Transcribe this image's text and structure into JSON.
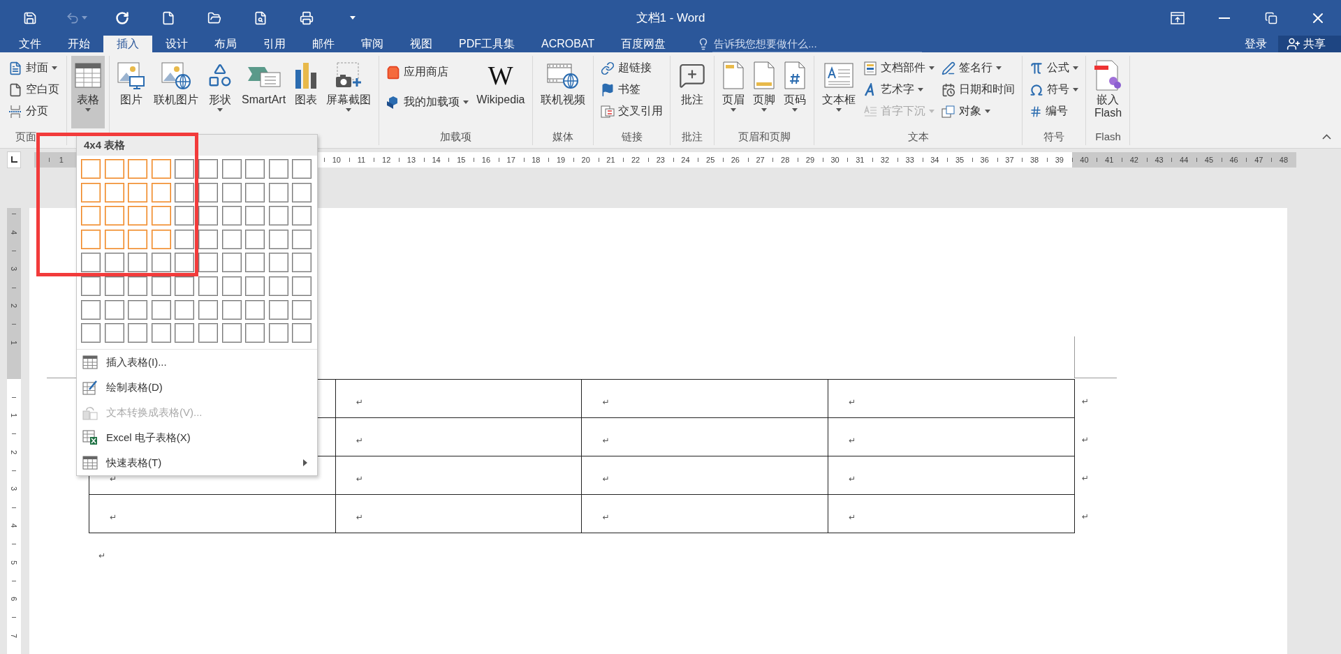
{
  "window": {
    "title": "文档1 - Word"
  },
  "quick_access": [
    {
      "kind": "save",
      "disabled": false,
      "dropdown": false
    },
    {
      "kind": "undo",
      "disabled": true,
      "dropdown": true
    },
    {
      "kind": "repeat",
      "disabled": false,
      "dropdown": false
    },
    {
      "kind": "new",
      "disabled": false,
      "dropdown": false
    },
    {
      "kind": "open",
      "disabled": false,
      "dropdown": false
    },
    {
      "kind": "preview",
      "disabled": false,
      "dropdown": false
    },
    {
      "kind": "print",
      "disabled": false,
      "dropdown": false
    },
    {
      "kind": "customize",
      "disabled": false,
      "dropdown": true
    }
  ],
  "ribbon_tabs": [
    {
      "label": "文件",
      "selected": false
    },
    {
      "label": "开始",
      "selected": false
    },
    {
      "label": "插入",
      "selected": true
    },
    {
      "label": "设计",
      "selected": false
    },
    {
      "label": "布局",
      "selected": false
    },
    {
      "label": "引用",
      "selected": false
    },
    {
      "label": "邮件",
      "selected": false
    },
    {
      "label": "审阅",
      "selected": false
    },
    {
      "label": "视图",
      "selected": false
    },
    {
      "label": "PDF工具集",
      "selected": false
    },
    {
      "label": "ACROBAT",
      "selected": false
    },
    {
      "label": "百度网盘",
      "selected": false
    }
  ],
  "tell_me": {
    "placeholder": "告诉我您想要做什么..."
  },
  "account": {
    "sign_in": "登录",
    "share": "共享"
  },
  "ribbon_groups": [
    {
      "label": "页面",
      "items": [
        {
          "kind": "stack",
          "items": [
            {
              "kind": "cover",
              "label": "封面",
              "dropdown": true,
              "disabled": false
            },
            {
              "kind": "blank",
              "label": "空白页",
              "dropdown": false,
              "disabled": false
            },
            {
              "kind": "pagebreak",
              "label": "分页",
              "dropdown": false,
              "disabled": false
            }
          ]
        }
      ]
    },
    {
      "items": [
        {
          "kind": "large",
          "label": "表格",
          "dropdown": true,
          "pressed": true
        }
      ]
    },
    {
      "items": [
        {
          "kind": "large",
          "label": "图片",
          "dropdown": false,
          "pressed": false
        },
        {
          "kind": "large",
          "label": "联机图片",
          "dropdown": false,
          "pressed": false
        },
        {
          "kind": "large",
          "label": "形状",
          "dropdown": true,
          "pressed": false
        },
        {
          "kind": "large",
          "label": "SmartArt",
          "dropdown": false,
          "pressed": false
        },
        {
          "kind": "large",
          "label": "图表",
          "dropdown": false,
          "pressed": false
        },
        {
          "kind": "large",
          "label": "屏幕截图",
          "dropdown": true,
          "pressed": false
        }
      ]
    },
    {
      "label": "加载项",
      "items": [
        {
          "kind": "stack",
          "items": [
            {
              "kind": "store",
              "label": "应用商店",
              "dropdown": false,
              "disabled": false
            },
            {
              "kind": "addins",
              "label": "我的加载项",
              "dropdown": true,
              "disabled": false
            }
          ]
        },
        {
          "kind": "large",
          "logo": "W",
          "label": "Wikipedia",
          "dropdown": false,
          "pressed": false
        }
      ]
    },
    {
      "label": "媒体",
      "items": [
        {
          "kind": "large",
          "label": "联机视频",
          "dropdown": false,
          "pressed": false
        }
      ]
    },
    {
      "label": "链接",
      "items": [
        {
          "kind": "stack",
          "items": [
            {
              "kind": "link",
              "label": "超链接",
              "dropdown": false,
              "disabled": false
            },
            {
              "kind": "bookmark",
              "label": "书签",
              "dropdown": false,
              "disabled": false
            },
            {
              "kind": "crossref",
              "label": "交叉引用",
              "dropdown": false,
              "disabled": false
            }
          ]
        }
      ]
    },
    {
      "label": "批注",
      "items": [
        {
          "kind": "large",
          "label": "批注",
          "dropdown": false,
          "pressed": false
        }
      ]
    },
    {
      "label": "页眉和页脚",
      "items": [
        {
          "kind": "large",
          "label": "页眉",
          "dropdown": true,
          "pressed": false
        },
        {
          "kind": "large",
          "label": "页脚",
          "dropdown": true,
          "pressed": false
        },
        {
          "kind": "large",
          "label": "页码",
          "dropdown": true,
          "pressed": false
        }
      ]
    },
    {
      "label": "文本",
      "items": [
        {
          "kind": "large",
          "label": "文本框",
          "dropdown": true,
          "pressed": false
        },
        {
          "kind": "stack",
          "items": [
            {
              "kind": "quickparts",
              "label": "文档部件",
              "dropdown": true,
              "disabled": false
            },
            {
              "kind": "wordart",
              "label": "艺术字",
              "dropdown": true,
              "disabled": false
            },
            {
              "kind": "dropcap",
              "label": "首字下沉",
              "dropdown": true,
              "disabled": true
            }
          ]
        },
        {
          "kind": "stack",
          "items": [
            {
              "kind": "signature",
              "label": "签名行",
              "dropdown": true,
              "disabled": false
            },
            {
              "kind": "datetime",
              "label": "日期和时间",
              "dropdown": false,
              "disabled": false
            },
            {
              "kind": "object",
              "label": "对象",
              "dropdown": true,
              "disabled": false
            }
          ]
        }
      ]
    },
    {
      "label": "符号",
      "items": [
        {
          "kind": "stack",
          "items": [
            {
              "kind": "equation",
              "label": "公式",
              "dropdown": true,
              "disabled": false
            },
            {
              "kind": "symbol",
              "label": "符号",
              "dropdown": true,
              "disabled": false
            },
            {
              "kind": "number",
              "label": "编号",
              "dropdown": false,
              "disabled": false
            }
          ]
        }
      ]
    },
    {
      "label": "Flash",
      "items": [
        {
          "kind": "large",
          "label": "嵌入\nFlash",
          "dropdown": false,
          "pressed": false
        }
      ]
    }
  ],
  "horizontal_ruler": {
    "left_labels": [
      "1"
    ],
    "labels": [
      "10",
      "11",
      "12",
      "13",
      "14",
      "15",
      "16",
      "17",
      "18",
      "19",
      "20",
      "21",
      "22",
      "23",
      "24",
      "25",
      "26",
      "27",
      "28",
      "29",
      "30",
      "31",
      "32",
      "33",
      "34",
      "35",
      "36",
      "37",
      "38",
      "39"
    ],
    "right_labels": [
      "40",
      "41",
      "42",
      "43",
      "44",
      "45",
      "46",
      "47",
      "48"
    ]
  },
  "vertical_ruler": {
    "top_labels": [
      "4",
      "3",
      "2",
      "1"
    ],
    "labels": [
      "1",
      "2",
      "3",
      "4",
      "5",
      "6",
      "7"
    ]
  },
  "table_picker": {
    "title": "4x4 表格",
    "rows": [
      {
        "cells": [
          {
            "selected": true
          },
          {
            "selected": true
          },
          {
            "selected": true
          },
          {
            "selected": true
          },
          {
            "selected": false
          },
          {
            "selected": false
          },
          {
            "selected": false
          },
          {
            "selected": false
          },
          {
            "selected": false
          },
          {
            "selected": false
          }
        ]
      },
      {
        "cells": [
          {
            "selected": true
          },
          {
            "selected": true
          },
          {
            "selected": true
          },
          {
            "selected": true
          },
          {
            "selected": false
          },
          {
            "selected": false
          },
          {
            "selected": false
          },
          {
            "selected": false
          },
          {
            "selected": false
          },
          {
            "selected": false
          }
        ]
      },
      {
        "cells": [
          {
            "selected": true
          },
          {
            "selected": true
          },
          {
            "selected": true
          },
          {
            "selected": true
          },
          {
            "selected": false
          },
          {
            "selected": false
          },
          {
            "selected": false
          },
          {
            "selected": false
          },
          {
            "selected": false
          },
          {
            "selected": false
          }
        ]
      },
      {
        "cells": [
          {
            "selected": true
          },
          {
            "selected": true
          },
          {
            "selected": true
          },
          {
            "selected": true
          },
          {
            "selected": false
          },
          {
            "selected": false
          },
          {
            "selected": false
          },
          {
            "selected": false
          },
          {
            "selected": false
          },
          {
            "selected": false
          }
        ]
      },
      {
        "cells": [
          {
            "selected": false
          },
          {
            "selected": false
          },
          {
            "selected": false
          },
          {
            "selected": false
          },
          {
            "selected": false
          },
          {
            "selected": false
          },
          {
            "selected": false
          },
          {
            "selected": false
          },
          {
            "selected": false
          },
          {
            "selected": false
          }
        ]
      },
      {
        "cells": [
          {
            "selected": false
          },
          {
            "selected": false
          },
          {
            "selected": false
          },
          {
            "selected": false
          },
          {
            "selected": false
          },
          {
            "selected": false
          },
          {
            "selected": false
          },
          {
            "selected": false
          },
          {
            "selected": false
          },
          {
            "selected": false
          }
        ]
      },
      {
        "cells": [
          {
            "selected": false
          },
          {
            "selected": false
          },
          {
            "selected": false
          },
          {
            "selected": false
          },
          {
            "selected": false
          },
          {
            "selected": false
          },
          {
            "selected": false
          },
          {
            "selected": false
          },
          {
            "selected": false
          },
          {
            "selected": false
          }
        ]
      },
      {
        "cells": [
          {
            "selected": false
          },
          {
            "selected": false
          },
          {
            "selected": false
          },
          {
            "selected": false
          },
          {
            "selected": false
          },
          {
            "selected": false
          },
          {
            "selected": false
          },
          {
            "selected": false
          },
          {
            "selected": false
          },
          {
            "selected": false
          }
        ]
      }
    ]
  },
  "table_menu": [
    {
      "kind": "insert",
      "label": "插入表格(I)...",
      "disabled": false,
      "submenu": false
    },
    {
      "kind": "draw",
      "label": "绘制表格(D)",
      "disabled": false,
      "submenu": false
    },
    {
      "kind": "convert",
      "label": "文本转换成表格(V)...",
      "disabled": true,
      "submenu": false
    },
    {
      "kind": "excel",
      "label": "Excel 电子表格(X)",
      "disabled": false,
      "submenu": false
    },
    {
      "kind": "quick",
      "label": "快速表格(T)",
      "disabled": false,
      "submenu": true
    }
  ],
  "document": {
    "table": {
      "rows": [
        {
          "cells": [
            {},
            {
              "mark": "↵"
            },
            {
              "mark": "↵"
            },
            {
              "mark": "↵"
            }
          ],
          "row_end": "↵"
        },
        {
          "cells": [
            {},
            {
              "mark": "↵"
            },
            {
              "mark": "↵"
            },
            {
              "mark": "↵"
            }
          ],
          "row_end": "↵"
        },
        {
          "cells": [
            {
              "mark": "↵"
            },
            {
              "mark": "↵"
            },
            {
              "mark": "↵"
            },
            {
              "mark": "↵"
            }
          ],
          "row_end": "↵"
        },
        {
          "cells": [
            {
              "mark": "↵"
            },
            {
              "mark": "↵"
            },
            {
              "mark": "↵"
            },
            {
              "mark": "↵"
            }
          ],
          "row_end": "↵"
        }
      ]
    },
    "paragraph_mark": "↵"
  }
}
